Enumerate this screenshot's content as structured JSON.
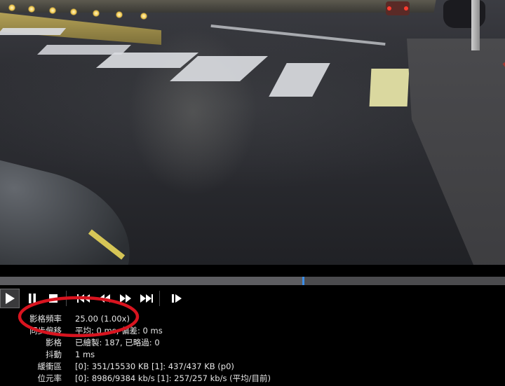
{
  "player": {
    "seek": {
      "position_fraction": 0.6
    },
    "toolbar": {
      "buttons": [
        "play",
        "pause",
        "stop",
        "previous",
        "rewind",
        "fast-forward",
        "next",
        "frame-step"
      ]
    },
    "stats": {
      "frame_rate": {
        "label": "影格頻率",
        "value": "25.00 (1.00x)"
      },
      "sync_offset": {
        "label": "同步偏移",
        "value": "平均: 0 ms, 偏差: 0 ms"
      },
      "frames": {
        "label": "影格",
        "value": "已繪製: 187, 已略過: 0"
      },
      "jitter": {
        "label": "抖動",
        "value": "1 ms"
      },
      "buffers": {
        "label": "緩衝區",
        "value": "[0]: 351/15530 KB [1]: 437/437 KB (p0)"
      },
      "bitrate": {
        "label": "位元率",
        "value": "[0]: 8986/9384 kb/s [1]: 257/257 kb/s (平均/目前)"
      }
    },
    "highlight_color": "#d8141f",
    "accent_color": "#3b8ee8"
  }
}
